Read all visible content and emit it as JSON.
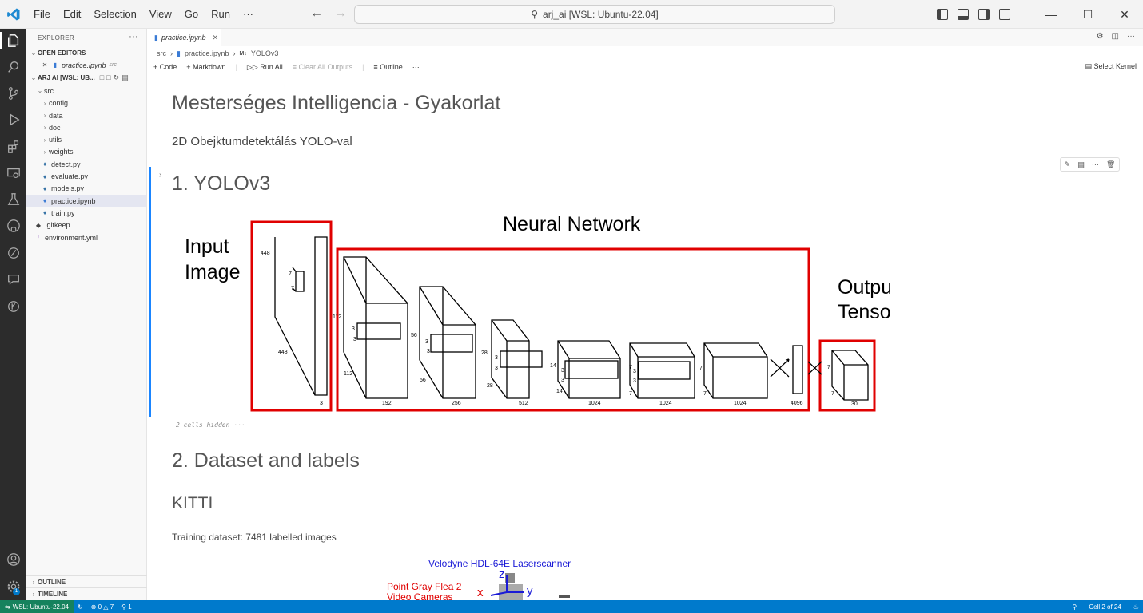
{
  "titlebar": {
    "menu": [
      "File",
      "Edit",
      "Selection",
      "View",
      "Go",
      "Run",
      "···"
    ],
    "search_text": "arj_ai [WSL: Ubuntu-22.04]"
  },
  "sidebar": {
    "header": "EXPLORER",
    "open_editors_label": "OPEN EDITORS",
    "open_editor_file": "practice.ipynb",
    "open_editor_dir": "src",
    "workspace_label": "ARJ AI [WSL: UB...",
    "tree": [
      {
        "label": "src",
        "type": "folder-open"
      },
      {
        "label": "config",
        "type": "folder"
      },
      {
        "label": "data",
        "type": "folder"
      },
      {
        "label": "doc",
        "type": "folder"
      },
      {
        "label": "utils",
        "type": "folder"
      },
      {
        "label": "weights",
        "type": "folder"
      },
      {
        "label": "detect.py",
        "type": "py"
      },
      {
        "label": "evaluate.py",
        "type": "py"
      },
      {
        "label": "models.py",
        "type": "py"
      },
      {
        "label": "practice.ipynb",
        "type": "nb"
      },
      {
        "label": "train.py",
        "type": "py"
      },
      {
        "label": ".gitkeep",
        "type": "git"
      },
      {
        "label": "environment.yml",
        "type": "yml"
      }
    ],
    "outline_label": "OUTLINE",
    "timeline_label": "TIMELINE"
  },
  "tab": {
    "label": "practice.ipynb"
  },
  "breadcrumb": {
    "part1": "src",
    "part2": "practice.ipynb",
    "part3_badge": "M↓",
    "part3": "YOLOv3"
  },
  "toolbar": {
    "code": "Code",
    "markdown": "Markdown",
    "run_all": "Run All",
    "clear_outputs": "Clear All Outputs",
    "outline": "Outline",
    "more": "···",
    "select_kernel": "Select Kernel"
  },
  "notebook": {
    "title": "Mesterséges Intelligencia - Gyakorlat",
    "subtitle": "2D Obejktumdetektálás YOLO-val",
    "section1": "1. YOLOv3",
    "hidden_cells": "2 cells hidden  ···",
    "section2": "2. Dataset and labels",
    "kitti": "KITTI",
    "training": "Training dataset: 7481 labelled images"
  },
  "diagram": {
    "input_label_1": "Input",
    "input_label_2": "Image",
    "neural_label": "Neural Network",
    "output_label_1": "Output",
    "output_label_2": "Tensor",
    "dims": {
      "in_448_top": "448",
      "in_7a": "7",
      "in_7b": "7",
      "in_448_bot": "448",
      "in_3": "3",
      "l1_112a": "112",
      "l1_3a": "3",
      "l1_3b": "3",
      "l1_112b": "112",
      "l1_192": "192",
      "l2_56a": "56",
      "l2_3a": "3",
      "l2_3b": "3",
      "l2_56b": "56",
      "l2_256": "256",
      "l3_28a": "28",
      "l3_3a": "3",
      "l3_3b": "3",
      "l3_28b": "28",
      "l3_512": "512",
      "l4_14a": "14",
      "l4_3a": "3",
      "l4_3b": "3",
      "l4_14b": "14",
      "l4_1024": "1024",
      "l5_7a": "7",
      "l5_3a": "3",
      "l5_3b": "3",
      "l5_7b": "7",
      "l5_1024": "1024",
      "l6_7a": "7",
      "l6_7b": "7",
      "l6_1024": "1024",
      "fc_4096": "4096",
      "out_7a": "7",
      "out_7b": "7",
      "out_30": "30"
    }
  },
  "kitti_figure": {
    "velodyne": "Velodyne HDL-64E Laserscanner",
    "pointgrey_1": "Point Gray Flea 2",
    "pointgrey_2": "Video Cameras",
    "z": "z",
    "x": "x",
    "y": "y"
  },
  "statusbar": {
    "remote": "WSL: Ubuntu-22.04",
    "errors": "0",
    "warnings": "7",
    "ports": "1",
    "cell": "Cell 2 of 24"
  },
  "colors": {
    "accent": "#007acc",
    "remote": "#16825d",
    "box_red": "#e00000",
    "activity": "#2c2c2c"
  }
}
